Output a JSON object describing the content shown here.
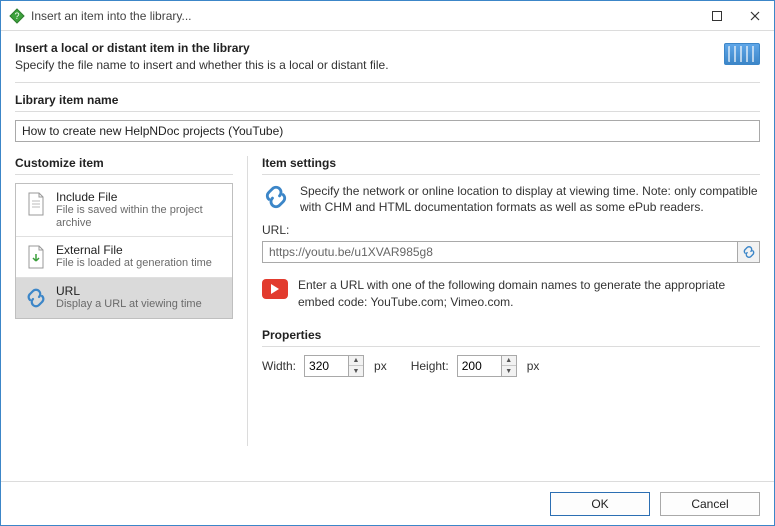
{
  "window": {
    "title": "Insert an item into the library..."
  },
  "header": {
    "title": "Insert a local or distant item in the library",
    "subtitle": "Specify the file name to insert and whether this is a local or distant file."
  },
  "name_section": {
    "label": "Library item name",
    "value": "How to create new HelpNDoc projects (YouTube)"
  },
  "customize": {
    "label": "Customize item",
    "items": [
      {
        "title": "Include File",
        "sub": "File is saved within the project archive"
      },
      {
        "title": "External File",
        "sub": "File is loaded at generation time"
      },
      {
        "title": "URL",
        "sub": "Display a URL at viewing time"
      }
    ]
  },
  "item_settings": {
    "label": "Item settings",
    "desc": "Specify the network or online location to display at viewing time. Note: only compatible with CHM and HTML documentation formats as well as some ePub readers.",
    "url_label": "URL:",
    "url_value": "https://youtu.be/u1XVAR985g8",
    "hint": "Enter a URL with one of the following domain names to generate the appropriate embed code: YouTube.com; Vimeo.com."
  },
  "properties": {
    "label": "Properties",
    "width_label": "Width:",
    "width_value": "320",
    "height_label": "Height:",
    "height_value": "200",
    "unit": "px"
  },
  "footer": {
    "ok": "OK",
    "cancel": "Cancel"
  }
}
